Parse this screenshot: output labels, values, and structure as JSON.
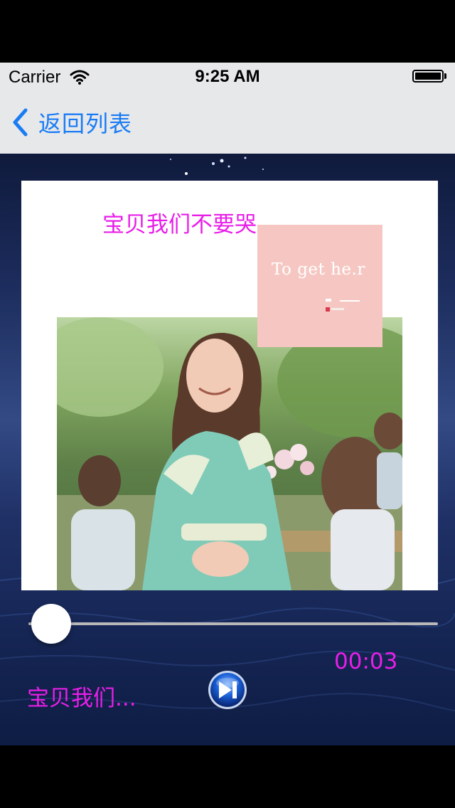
{
  "status_bar": {
    "carrier": "Carrier",
    "time": "9:25 AM",
    "wifi_icon": "wifi-icon",
    "battery_icon": "battery-icon"
  },
  "nav": {
    "back_label": "返回列表",
    "back_icon": "chevron-left-icon"
  },
  "album": {
    "title": "宝贝我们不要哭",
    "cover_text": "To get he.r"
  },
  "player": {
    "progress": 0.0,
    "current_time": "00:03",
    "song_name": "宝贝我们...",
    "play_icon": "play-next-icon"
  },
  "colors": {
    "accent": "#1a7cf5",
    "magenta_text": "#e81ee8",
    "bar_background": "#e7e8ea"
  }
}
